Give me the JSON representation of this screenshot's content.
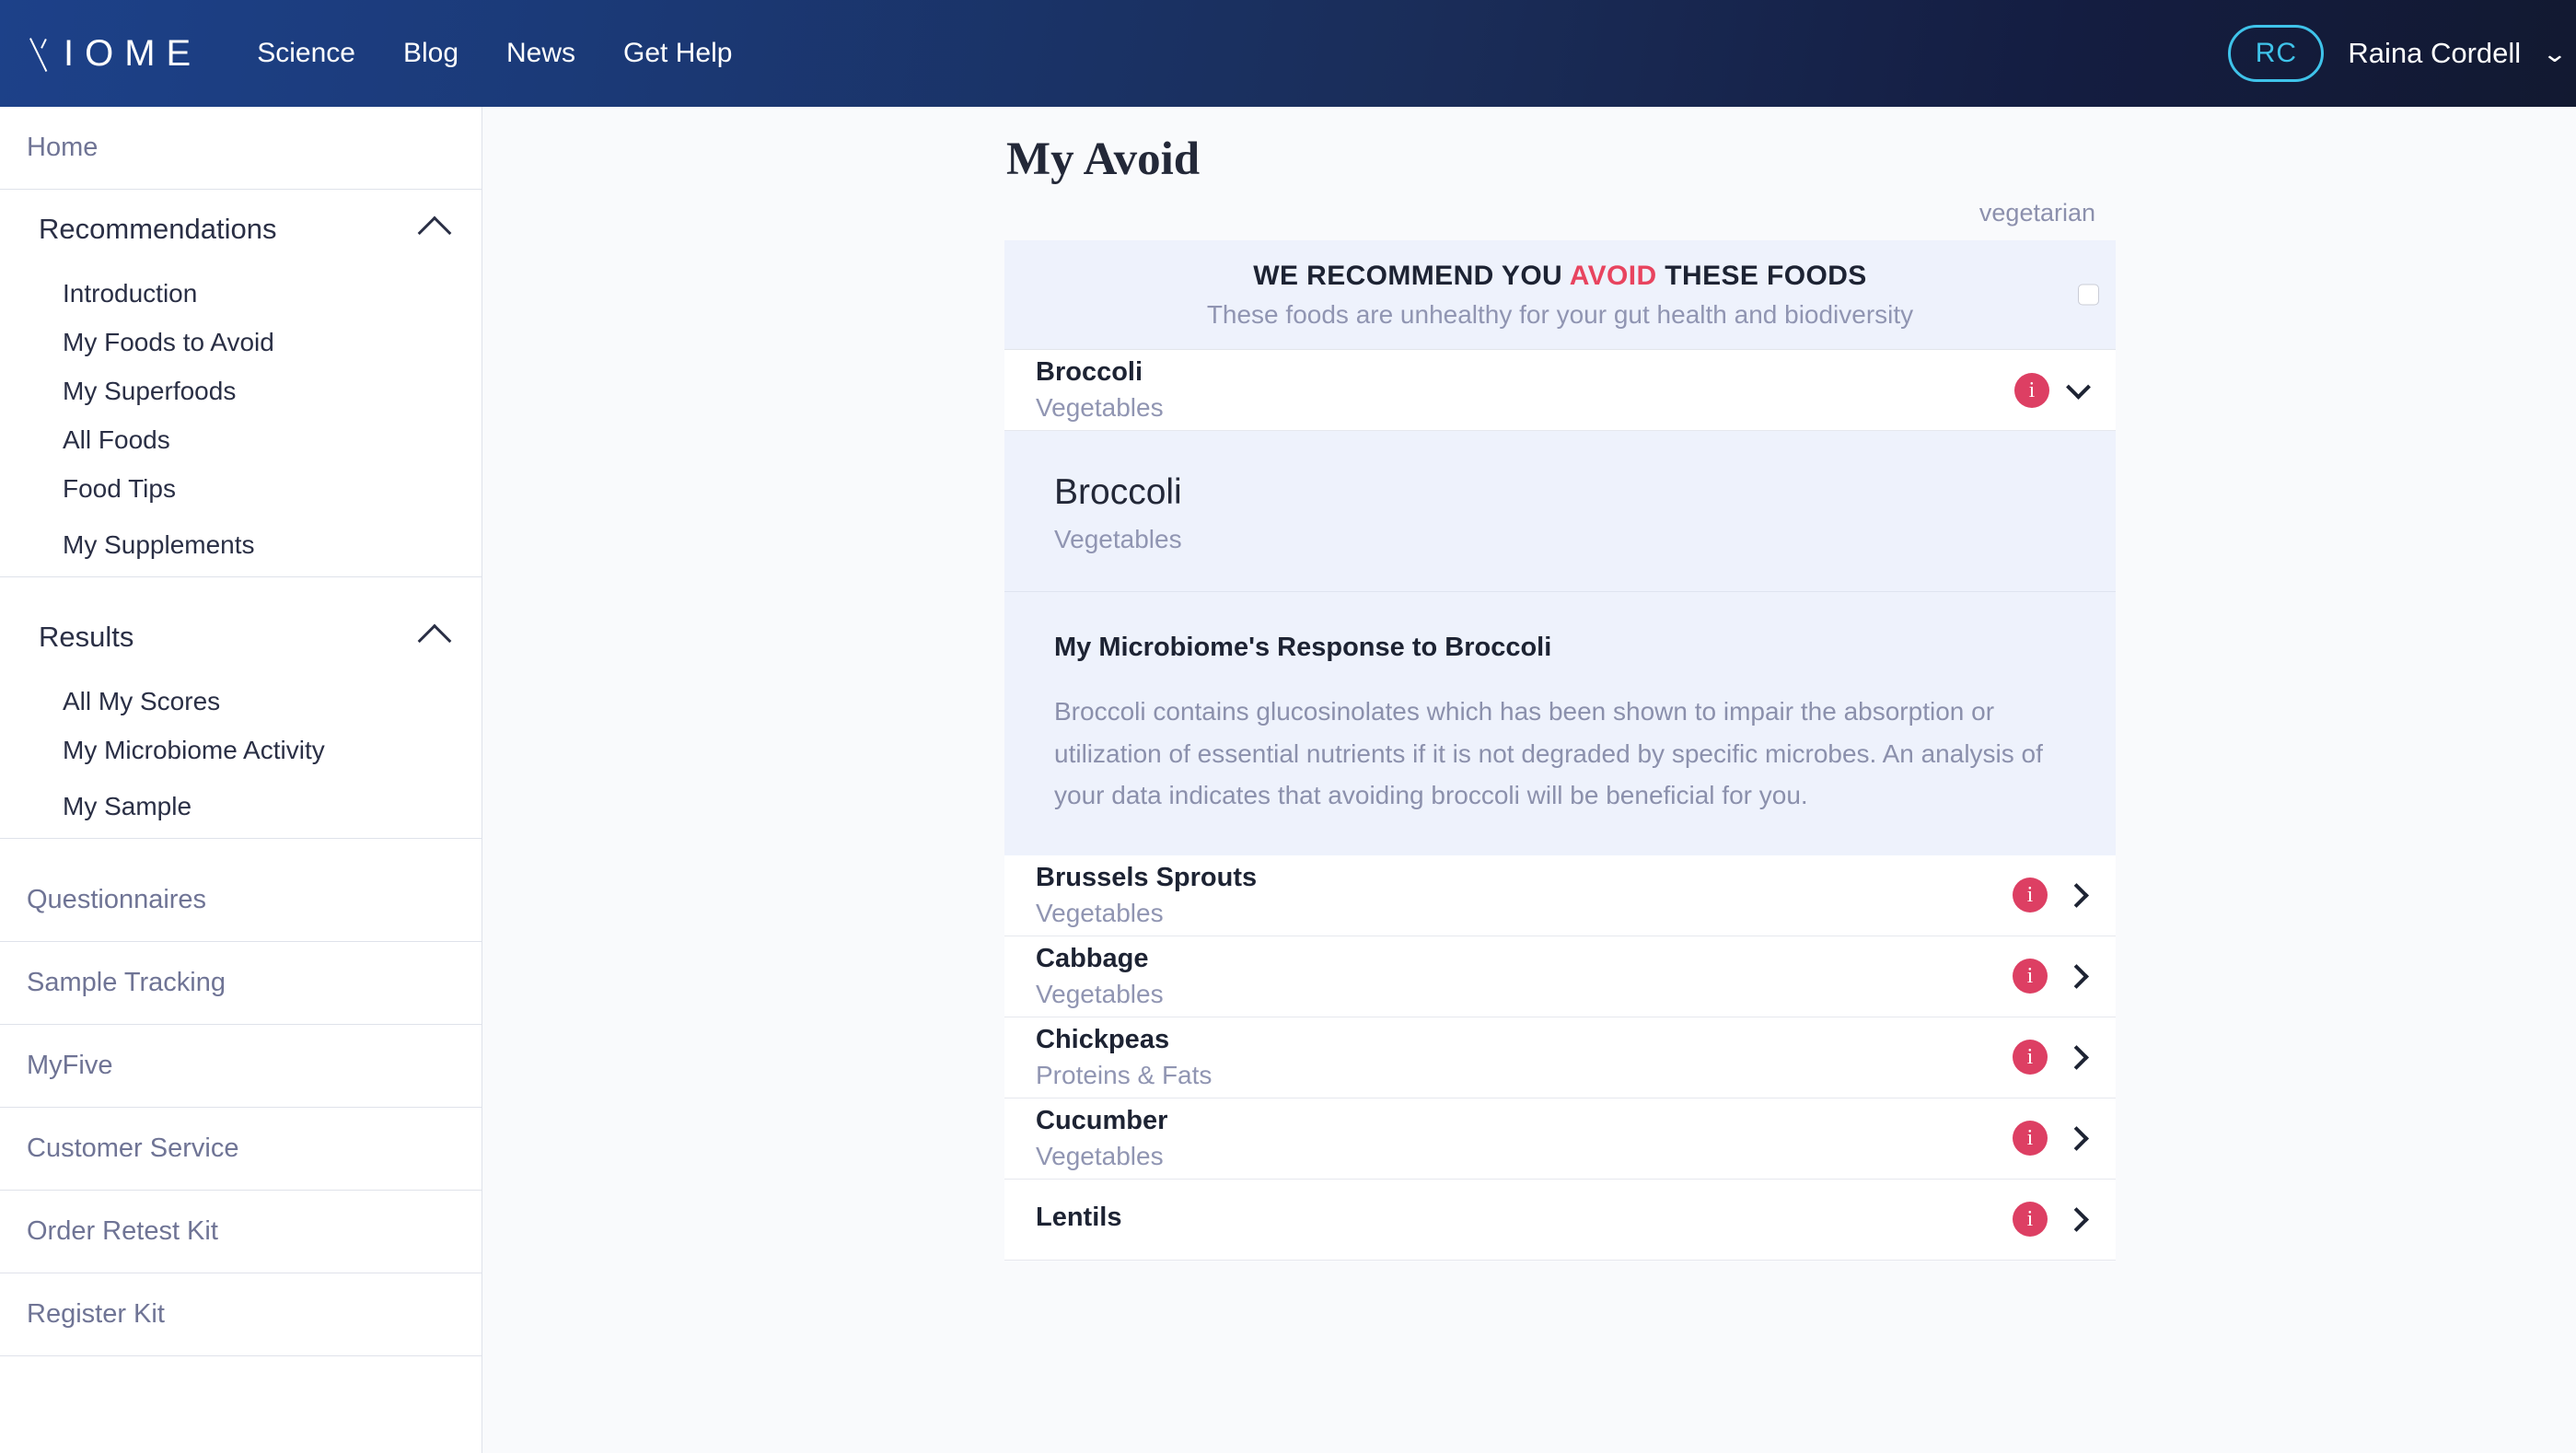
{
  "header": {
    "logo_text": "IOME",
    "logo_full": "VIOME",
    "nav": [
      {
        "label": "Science"
      },
      {
        "label": "Blog"
      },
      {
        "label": "News"
      },
      {
        "label": "Get Help"
      }
    ],
    "account": {
      "initials": "RC",
      "name": "Raina Cordell",
      "caret": "⌄"
    }
  },
  "sidebar": {
    "home": "Home",
    "groups": [
      {
        "label": "Recommendations",
        "items": [
          "Introduction",
          "My Foods to Avoid",
          "My Superfoods",
          "All Foods",
          "Food Tips",
          "My Supplements"
        ]
      },
      {
        "label": "Results",
        "items": [
          "All My Scores",
          "My Microbiome Activity",
          "My Sample"
        ]
      }
    ],
    "links": [
      "Questionnaires",
      "Sample Tracking",
      "MyFive",
      "Customer Service",
      "Order Retest Kit",
      "Register Kit"
    ]
  },
  "main": {
    "title": "My Avoid",
    "diet_tag": "vegetarian",
    "banner": {
      "title_before": "WE RECOMMEND YOU ",
      "title_highlight": "AVOID",
      "title_after": " THESE FOODS",
      "subtitle": "These foods are unhealthy for your gut health and biodiversity"
    },
    "info_icon_label": "i",
    "foods": [
      {
        "name": "Broccoli",
        "category": "Vegetables",
        "expanded": true
      },
      {
        "name": "Brussels Sprouts",
        "category": "Vegetables",
        "expanded": false
      },
      {
        "name": "Cabbage",
        "category": "Vegetables",
        "expanded": false
      },
      {
        "name": "Chickpeas",
        "category": "Proteins & Fats",
        "expanded": false
      },
      {
        "name": "Cucumber",
        "category": "Vegetables",
        "expanded": false
      },
      {
        "name": "Lentils",
        "category": "",
        "expanded": false
      }
    ],
    "detail": {
      "name": "Broccoli",
      "category": "Vegetables",
      "section_title": "My Microbiome's Response to Broccoli",
      "body": "Broccoli contains glucosinolates which has been shown to impair the absorption or utilization of essential nutrients if it is not degraded by specific microbes. An analysis of your data indicates that avoiding broccoli will be beneficial for you."
    }
  },
  "colors": {
    "header_gradient_start": "#1d4189",
    "header_gradient_end": "#121931",
    "accent_cyan": "#3fc3ea",
    "accent_red": "#e8445f",
    "info_badge": "#dd3f63",
    "banner_bg": "#eef2fc",
    "muted_text": "#9095b2"
  }
}
